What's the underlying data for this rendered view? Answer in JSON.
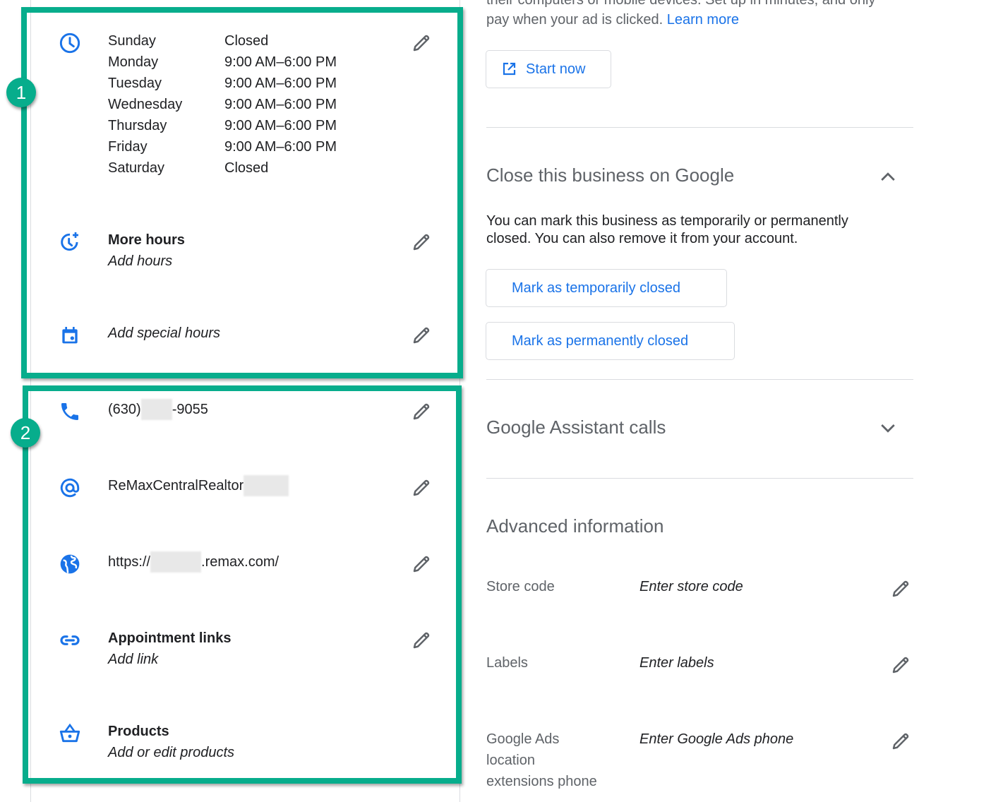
{
  "hours": {
    "rows": [
      {
        "day": "Sunday",
        "time": "Closed"
      },
      {
        "day": "Monday",
        "time": "9:00 AM–6:00 PM"
      },
      {
        "day": "Tuesday",
        "time": "9:00 AM–6:00 PM"
      },
      {
        "day": "Wednesday",
        "time": "9:00 AM–6:00 PM"
      },
      {
        "day": "Thursday",
        "time": "9:00 AM–6:00 PM"
      },
      {
        "day": "Friday",
        "time": "9:00 AM–6:00 PM"
      },
      {
        "day": "Saturday",
        "time": "Closed"
      }
    ],
    "more_hours_title": "More hours",
    "more_hours_sub": "Add hours",
    "special_hours": "Add special hours"
  },
  "contact": {
    "phone_prefix": "(630)",
    "phone_suffix": "-9055",
    "email_prefix": "ReMaxCentralRealtor",
    "website_prefix": "https://",
    "website_suffix": ".remax.com/",
    "appointment_title": "Appointment links",
    "appointment_sub": "Add link",
    "products_title": "Products",
    "products_sub": "Add or edit products"
  },
  "annotations": {
    "badge_1": "1",
    "badge_2": "2",
    "highlight_color": "#07ad8c"
  },
  "ads": {
    "text_top_partial": "their computers or mobile devices. Set up in minutes, and only",
    "text_line2": "pay when your ad is clicked.",
    "learn_more": "Learn more",
    "start_now": "Start now"
  },
  "close_business": {
    "title": "Close this business on Google",
    "description_line1": "You can mark this business as temporarily or permanently",
    "description_line2": "closed. You can also remove it from your account.",
    "temp_button": "Mark as temporarily closed",
    "perm_button": "Mark as permanently closed"
  },
  "assistant": {
    "title": "Google Assistant calls"
  },
  "advanced": {
    "title": "Advanced information",
    "rows": [
      {
        "label": "Store code",
        "value": "Enter store code"
      },
      {
        "label": "Labels",
        "value": "Enter labels"
      },
      {
        "label_lines": [
          "Google Ads",
          "location",
          "extensions phone"
        ],
        "value": "Enter Google Ads phone"
      }
    ]
  },
  "colors": {
    "accent": "#1a73e8",
    "icon_gray": "#5f6368",
    "divider": "#dadce0"
  }
}
